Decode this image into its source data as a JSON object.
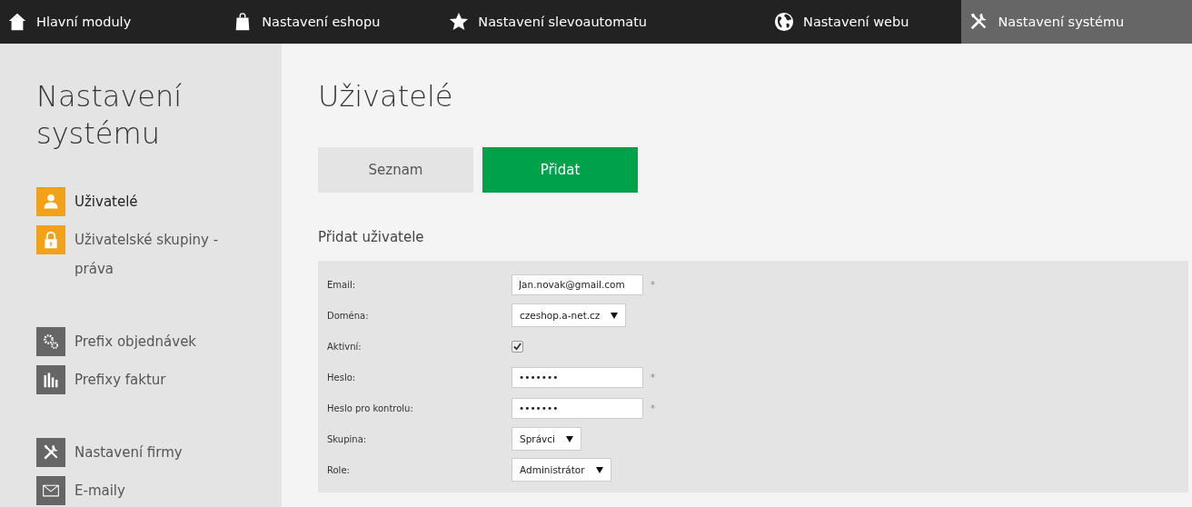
{
  "top_nav": [
    {
      "label": "Hlavní moduly",
      "selected": false
    },
    {
      "label": "Nastavení eshopu",
      "selected": false
    },
    {
      "label": "Nastavení slevoautomatu",
      "selected": false
    },
    {
      "label": "Nastavení webu",
      "selected": false
    },
    {
      "label": "Nastavení systému",
      "selected": true
    }
  ],
  "sidebar": {
    "title": "Nastavení systému",
    "groups": [
      {
        "items": [
          {
            "label": "Uživatelé",
            "color": "#f4a11a",
            "selected": true
          },
          {
            "label": "Uživatelské skupiny - práva",
            "color": "#f4a11a",
            "selected": false
          }
        ]
      },
      {
        "items": [
          {
            "label": "Prefix objednávek",
            "color": "#666666",
            "selected": false
          },
          {
            "label": "Prefixy faktur",
            "color": "#666666",
            "selected": false
          }
        ]
      },
      {
        "items": [
          {
            "label": "Nastavení firmy",
            "color": "#666666",
            "selected": false
          },
          {
            "label": "E-maily",
            "color": "#666666",
            "selected": false
          }
        ]
      }
    ]
  },
  "page_title": "Uživatelé",
  "mode_tabs": [
    {
      "label": "Seznam",
      "selected": false
    },
    {
      "label": "Přidat",
      "selected": true
    }
  ],
  "form": {
    "title": "Přidat uživatele",
    "fields": [
      {
        "label": "Email:",
        "kind": "text",
        "value": "Jan.novak@gmail.com",
        "required": true
      },
      {
        "label": "Doména:",
        "kind": "select",
        "value": "czeshop.a-net.cz",
        "required": false
      },
      {
        "label": "Aktivní:",
        "kind": "checkbox",
        "checked": true,
        "required": false
      },
      {
        "label": "Heslo:",
        "kind": "text",
        "value": "•••••••",
        "required": true
      },
      {
        "label": "Heslo pro kontrolu:",
        "kind": "text",
        "value": "•••••••",
        "required": true
      },
      {
        "label": "Skupina:",
        "kind": "select",
        "value": "Správci",
        "required": false
      },
      {
        "label": "Role:",
        "kind": "select",
        "value": "Administrátor",
        "required": false
      }
    ]
  },
  "required_mark": "*"
}
